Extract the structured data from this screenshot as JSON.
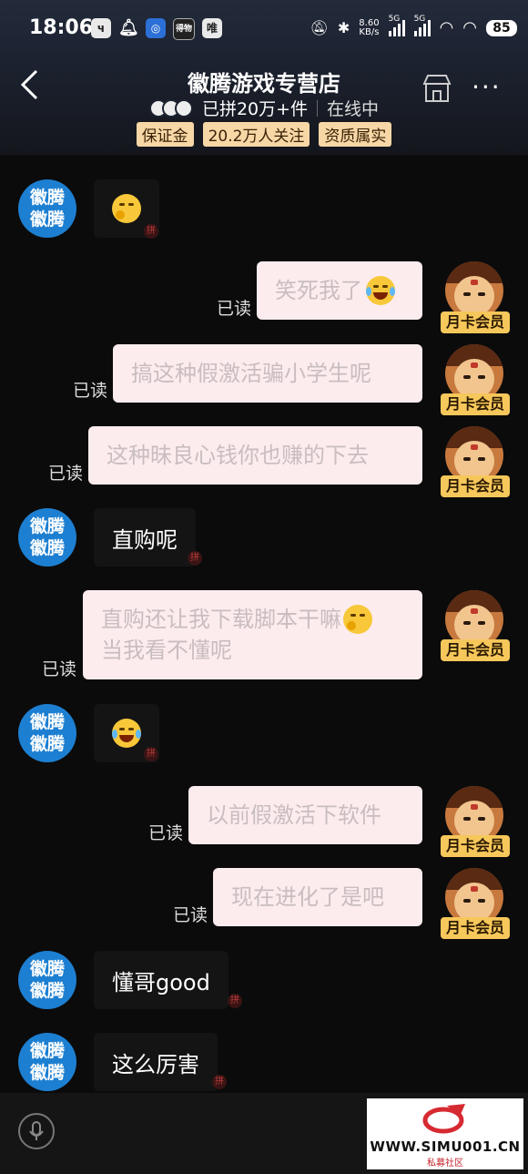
{
  "status_bar": {
    "time": "18:06",
    "left_icons": [
      "app-icon-1",
      "bell-icon",
      "app-icon-2",
      "app-icon-3",
      "app-icon-4"
    ],
    "net_speed": "8.60",
    "net_speed_unit": "KB/s",
    "signal_1": "5G",
    "signal_2": "5G",
    "battery": "85"
  },
  "header": {
    "title": "徽腾游戏专营店",
    "sold": "已拼20万+件",
    "status": "在线中",
    "tags": [
      "保证金",
      "20.2万人关注",
      "资质属实"
    ]
  },
  "shop": {
    "avatar_text_1": "徽腾",
    "avatar_text_2": "徽腾"
  },
  "user": {
    "badge": "月卡会员"
  },
  "read_label": "已读",
  "messages": [
    {
      "from": "shop",
      "text": ""
    },
    {
      "from": "user",
      "text": "笑死我了"
    },
    {
      "from": "user",
      "text": "搞这种假激活骗小学生呢"
    },
    {
      "from": "user",
      "text": "这种昧良心钱你也赚的下去"
    },
    {
      "from": "shop",
      "text": "直购呢"
    },
    {
      "from": "user",
      "text": "直购还让我下载脚本干嘛",
      "text2": "当我看不懂呢"
    },
    {
      "from": "shop",
      "text": ""
    },
    {
      "from": "user",
      "text": "以前假激活下软件"
    },
    {
      "from": "user",
      "text": "现在进化了是吧"
    },
    {
      "from": "shop",
      "text": "懂哥good"
    },
    {
      "from": "shop",
      "text": "这么厉害"
    }
  ],
  "watermark": {
    "url": "WWW.SIMU001.CN",
    "sub": "私募社区"
  },
  "colors": {
    "shop_avatar": "#1d7fd1",
    "user_bubble": "#fcecee",
    "tag_bg": "#f7d7a6",
    "vip_badge": "#f6c75a"
  }
}
